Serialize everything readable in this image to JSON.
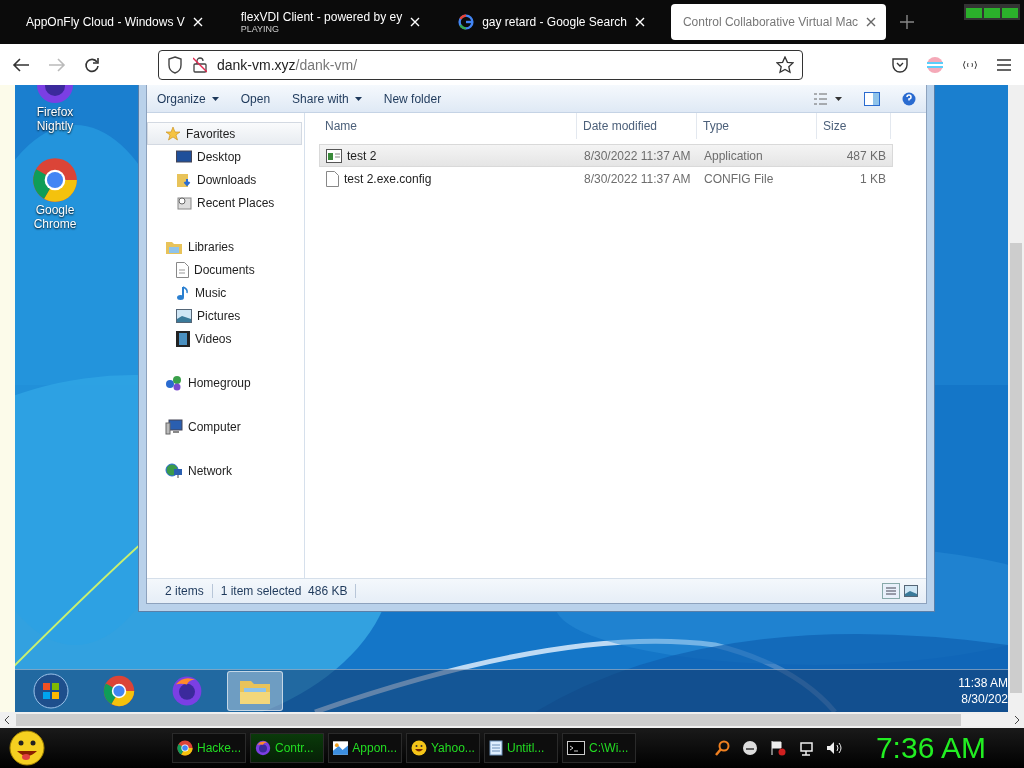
{
  "browser": {
    "tabs": [
      {
        "title": "AppOnFly Cloud - Windows V",
        "kind": "plain",
        "selected": false
      },
      {
        "title": "flexVDI Client - powered by ey",
        "subtitle": "PLAYING",
        "kind": "plain",
        "selected": false
      },
      {
        "title": "gay retard - Google Search",
        "kind": "google",
        "selected": false
      },
      {
        "title": "Control Collaborative Virtual Mac",
        "kind": "plain",
        "selected": true
      }
    ],
    "address": {
      "host": "dank-vm.xyz",
      "path": "/dank-vm/"
    }
  },
  "desktop_icons": [
    {
      "label": "Firefox Nightly",
      "kind": "firefox"
    },
    {
      "label": "Google Chrome",
      "kind": "chrome"
    }
  ],
  "explorer": {
    "toolbar": [
      {
        "label": "Organize",
        "dropdown": true
      },
      {
        "label": "Open",
        "dropdown": false
      },
      {
        "label": "Share with",
        "dropdown": true
      },
      {
        "label": "New folder",
        "dropdown": false
      }
    ],
    "nav": [
      {
        "label": "Favorites",
        "kind": "star",
        "selected": true,
        "children": [
          {
            "label": "Desktop",
            "kind": "desktop"
          },
          {
            "label": "Downloads",
            "kind": "downloads"
          },
          {
            "label": "Recent Places",
            "kind": "recent"
          }
        ]
      },
      {
        "label": "Libraries",
        "kind": "libraries",
        "selected": false,
        "children": [
          {
            "label": "Documents",
            "kind": "document"
          },
          {
            "label": "Music",
            "kind": "music"
          },
          {
            "label": "Pictures",
            "kind": "pictures"
          },
          {
            "label": "Videos",
            "kind": "videos"
          }
        ]
      },
      {
        "label": "Homegroup",
        "kind": "homegroup",
        "selected": false
      },
      {
        "label": "Computer",
        "kind": "computer",
        "selected": false
      },
      {
        "label": "Network",
        "kind": "network",
        "selected": false
      }
    ],
    "columns": [
      "Name",
      "Date modified",
      "Type",
      "Size"
    ],
    "rows": [
      {
        "name": "test 2",
        "date": "8/30/2022 11:37 AM",
        "type": "Application",
        "size": "487 KB",
        "kind": "app",
        "selected": true
      },
      {
        "name": "test 2.exe.config",
        "date": "8/30/2022 11:37 AM",
        "type": "CONFIG File",
        "size": "1 KB",
        "kind": "file",
        "selected": false
      }
    ],
    "status": [
      "2 items",
      "1 item selected  486 KB"
    ]
  },
  "win_taskbar": {
    "buttons": [
      {
        "kind": "start",
        "selected": false
      },
      {
        "kind": "chrome",
        "selected": false
      },
      {
        "kind": "firefox",
        "selected": false
      },
      {
        "kind": "explorer",
        "selected": true
      }
    ],
    "time": "11:38 AM",
    "date": "8/30/202"
  },
  "host_taskbar": {
    "items": [
      {
        "label": "Hacke...",
        "kind": "chrome",
        "selected": false
      },
      {
        "label": "Contr...",
        "kind": "firefox",
        "selected": true
      },
      {
        "label": "Appon...",
        "kind": "appon",
        "selected": false
      },
      {
        "label": "Yahoo...",
        "kind": "smiley",
        "selected": false
      },
      {
        "label": "Untitl...",
        "kind": "notepad",
        "selected": false
      },
      {
        "label": "C:\\Wi...",
        "kind": "cmd",
        "selected": false
      }
    ],
    "clock": "7:36 AM"
  }
}
